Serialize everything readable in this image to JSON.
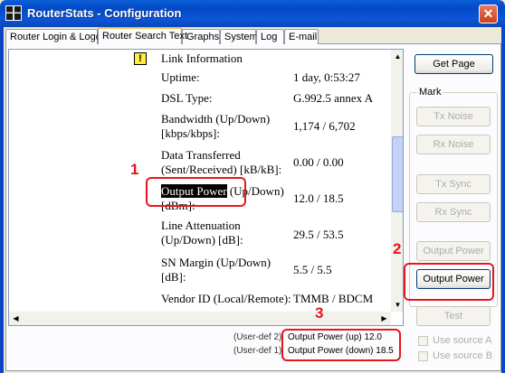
{
  "window": {
    "title": "RouterStats - Configuration",
    "close_glyph": "✕"
  },
  "tabs": [
    {
      "label": "Router Login & Logout"
    },
    {
      "label": "Router Search Text"
    },
    {
      "label": "Graphs"
    },
    {
      "label": "System"
    },
    {
      "label": "Log"
    },
    {
      "label": "E-mail"
    }
  ],
  "content": {
    "warning_glyph": "!",
    "section_title": "Link Information",
    "rows": [
      {
        "label": "Uptime:",
        "value": "1 day, 0:53:27"
      },
      {
        "label": "DSL Type:",
        "value": "G.992.5 annex A"
      },
      {
        "label_1": "Bandwidth (Up/Down)",
        "label_2": "[kbps/kbps]:",
        "value": "1,174 / 6,702"
      },
      {
        "label_1": "Data Transferred",
        "label_2": "(Sent/Received) [kB/kB]:",
        "value": "0.00 / 0.00"
      },
      {
        "label_hl": "Output Power",
        "label_1_rest": " (Up/Down)",
        "label_2": "[dBm]:",
        "value": "12.0 / 18.5"
      },
      {
        "label_1": "Line Attenuation",
        "label_2": "(Up/Down) [dB]:",
        "value": "29.5 / 53.5"
      },
      {
        "label_1": "SN Margin (Up/Down)",
        "label_2": "[dB]:",
        "value": "5.5 / 5.5"
      },
      {
        "label": "Vendor ID (Local/Remote):",
        "value": "TMMB / BDCM"
      }
    ]
  },
  "sidebar": {
    "get_page": "Get Page",
    "mark_label": "Mark",
    "tx_noise": "Tx Noise",
    "rx_noise": "Rx Noise",
    "tx_sync": "Tx Sync",
    "rx_sync": "Rx Sync",
    "output_power_disabled": "Output Power",
    "output_power_active": "Output Power",
    "test": "Test",
    "use_source_a": "Use source A",
    "use_source_b": "Use source B"
  },
  "user_defs": [
    {
      "label": "(User-def 2)",
      "value": "Output Power (up)  12.0"
    },
    {
      "label": "(User-def 1)",
      "value": "Output Power (down)  18.5"
    }
  ],
  "annotations": {
    "n1": "1",
    "n2": "2",
    "n3": "3",
    "color": "#e8151c"
  }
}
